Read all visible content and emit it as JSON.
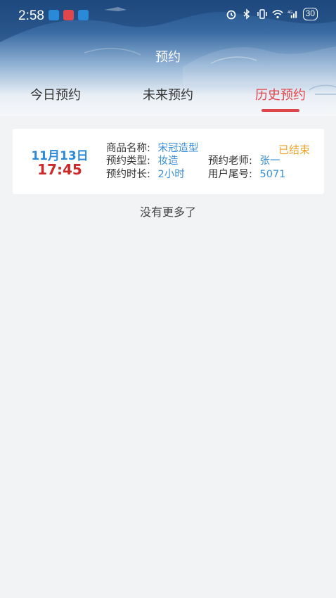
{
  "status_bar": {
    "time": "2:58",
    "battery": "30",
    "network": "4G",
    "app_icons": [
      {
        "name": "message-app-icon",
        "color": "#2b8ad8"
      },
      {
        "name": "mail-app-icon",
        "color": "#e0474c"
      },
      {
        "name": "map-app-icon",
        "color": "#2b8ad8"
      }
    ]
  },
  "header": {
    "title": "预约"
  },
  "tabs": [
    {
      "label": "今日预约",
      "active": false
    },
    {
      "label": "未来预约",
      "active": false
    },
    {
      "label": "历史预约",
      "active": true
    }
  ],
  "appointments": [
    {
      "date": "11月13日",
      "time": "17:45",
      "status": "已结束",
      "product_label": "商品名称:",
      "product_value": "宋冠造型",
      "type_label": "预约类型:",
      "type_value": "妆造",
      "teacher_label": "预约老师:",
      "teacher_value": "张一",
      "duration_label": "预约时长:",
      "duration_value": "2小时",
      "tail_label": "用户尾号:",
      "tail_value": "5071"
    }
  ],
  "list_footer": "没有更多了",
  "colors": {
    "accent_red": "#e0474c",
    "date_blue": "#2b8ad8",
    "status_orange": "#f0a32a"
  }
}
